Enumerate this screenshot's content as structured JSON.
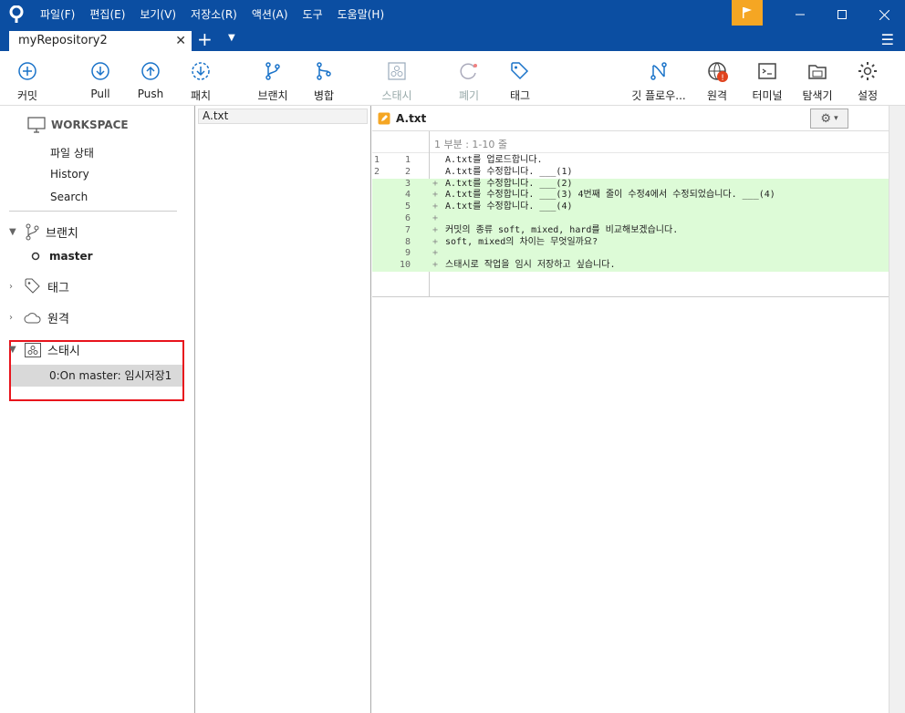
{
  "menu": [
    "파일(F)",
    "편집(E)",
    "보기(V)",
    "저장소(R)",
    "액션(A)",
    "도구",
    "도움말(H)"
  ],
  "tab": {
    "title": "myRepository2"
  },
  "toolbar": {
    "commit": "커밋",
    "pull": "Pull",
    "push": "Push",
    "fetch": "패치",
    "branch": "브랜치",
    "merge": "병합",
    "stash": "스태시",
    "discard": "폐기",
    "tag": "태그",
    "gitflow": "깃 플로우...",
    "remote": "원격",
    "terminal": "터미널",
    "explorer": "탐색기",
    "settings": "설정"
  },
  "sidebar": {
    "workspace": "WORKSPACE",
    "ws_items": [
      "파일 상태",
      "History",
      "Search"
    ],
    "branches": "브랜치",
    "branch_current": "master",
    "tags": "태그",
    "remotes": "원격",
    "stashes": "스태시",
    "stash_item": "0:On master: 임시저장1"
  },
  "filelist": {
    "header": "A.txt"
  },
  "diff": {
    "filename": "A.txt",
    "hunk": "1 부분 : 1-10 줄",
    "lines": [
      {
        "o": "1",
        "n": "1",
        "m": "",
        "t": "A.txt를 업로드합니다.",
        "add": false
      },
      {
        "o": "2",
        "n": "2",
        "m": "",
        "t": "A.txt를 수정합니다. ___(1)",
        "add": false
      },
      {
        "o": "",
        "n": "3",
        "m": "+",
        "t": "A.txt를 수정합니다. ___(2)",
        "add": true
      },
      {
        "o": "",
        "n": "4",
        "m": "+",
        "t": "A.txt를 수정합니다. ___(3) 4번째 줄이 수정4에서 수정되었습니다. ___(4)",
        "add": true
      },
      {
        "o": "",
        "n": "5",
        "m": "+",
        "t": "A.txt를 수정합니다. ___(4)",
        "add": true
      },
      {
        "o": "",
        "n": "6",
        "m": "+",
        "t": "",
        "add": true
      },
      {
        "o": "",
        "n": "7",
        "m": "+",
        "t": "커밋의 종류 soft, mixed, hard를 비교해보겠습니다.",
        "add": true
      },
      {
        "o": "",
        "n": "8",
        "m": "+",
        "t": "soft, mixed의 차이는 무엇일까요?",
        "add": true
      },
      {
        "o": "",
        "n": "9",
        "m": "+",
        "t": "",
        "add": true
      },
      {
        "o": "",
        "n": "10",
        "m": "+",
        "t": "스태시로 작업을 임시 저장하고 싶습니다.",
        "add": true
      }
    ]
  },
  "colors": {
    "titlebar": "#0b4ea2",
    "accent": "#1a73c9",
    "added_bg": "#ddfbd7",
    "highlight_border": "#e8141c",
    "flag": "#f5a623"
  }
}
